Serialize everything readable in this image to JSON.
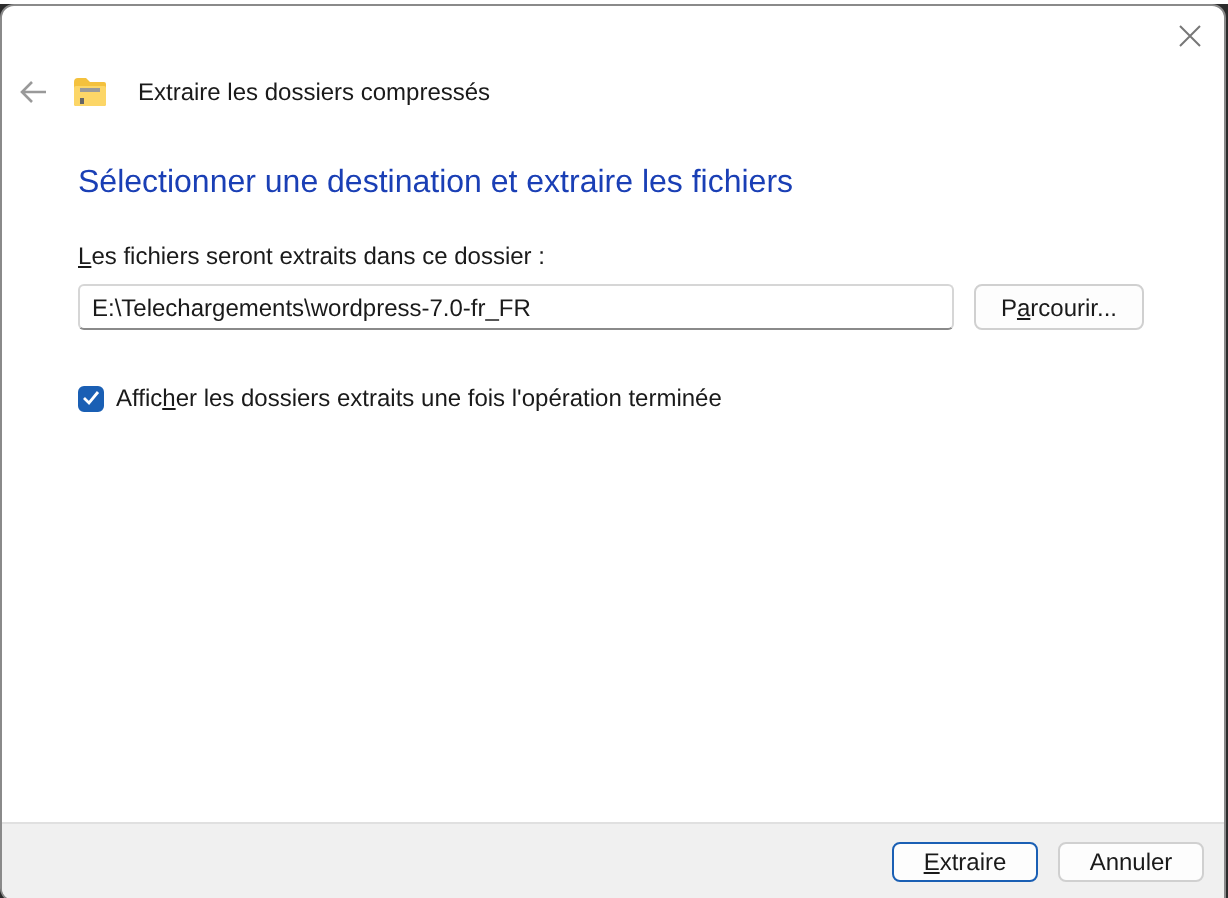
{
  "window": {
    "title": "Extraire les dossiers compressés"
  },
  "heading": "Sélectionner une destination et extraire les fichiers",
  "destination": {
    "label": {
      "access_key": "L",
      "after": "es fichiers seront extraits dans ce dossier :"
    },
    "value": "E:\\Telechargements\\wordpress-7.0-fr_FR",
    "browse_button": {
      "before": "P",
      "access_key": "a",
      "after": "rcourir..."
    }
  },
  "show_folders": {
    "label": {
      "before": "Affic",
      "access_key": "h",
      "after": "er les dossiers extraits une fois l'opération terminée"
    },
    "checked": true
  },
  "buttons": [
    {
      "label": {
        "access_key": "E",
        "after": "xtraire"
      },
      "default": true
    },
    {
      "label": {
        "before": "Annuler"
      },
      "default": false
    }
  ]
}
